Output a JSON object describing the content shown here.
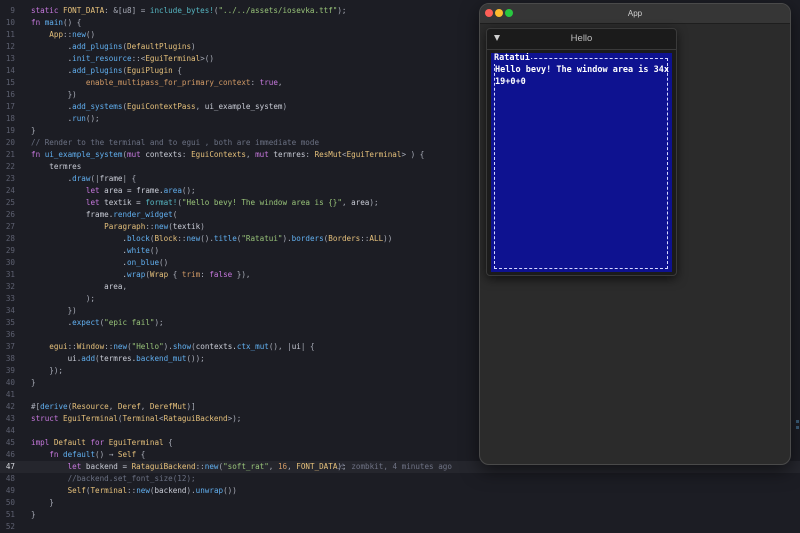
{
  "editor": {
    "lines": [
      {
        "n": "9",
        "parts": [
          [
            "t-kw",
            "static "
          ],
          [
            "t-ty",
            "FONT_DATA"
          ],
          [
            "t-punc",
            ": &[u8] = "
          ],
          [
            "t-mac",
            "include_bytes!"
          ],
          [
            "t-punc",
            "("
          ],
          [
            "t-str",
            "\"../../assets/iosevka.ttf\""
          ],
          [
            "t-punc",
            ");"
          ]
        ]
      },
      {
        "n": "10",
        "parts": [
          [
            "t-kw",
            "fn "
          ],
          [
            "t-fn",
            "main"
          ],
          [
            "t-punc",
            "() {"
          ]
        ]
      },
      {
        "n": "11",
        "parts": [
          [
            "t-plain",
            "    "
          ],
          [
            "t-ty",
            "App"
          ],
          [
            "t-punc",
            "::"
          ],
          [
            "t-fn",
            "new"
          ],
          [
            "t-punc",
            "()"
          ]
        ]
      },
      {
        "n": "12",
        "parts": [
          [
            "t-plain",
            "        ."
          ],
          [
            "t-fn",
            "add_plugins"
          ],
          [
            "t-punc",
            "("
          ],
          [
            "t-ty",
            "DefaultPlugins"
          ],
          [
            "t-punc",
            ")"
          ]
        ]
      },
      {
        "n": "13",
        "parts": [
          [
            "t-plain",
            "        ."
          ],
          [
            "t-fn",
            "init_resource"
          ],
          [
            "t-punc",
            "::<"
          ],
          [
            "t-ty",
            "EguiTerminal"
          ],
          [
            "t-punc",
            ">()"
          ]
        ]
      },
      {
        "n": "14",
        "parts": [
          [
            "t-plain",
            "        ."
          ],
          [
            "t-fn",
            "add_plugins"
          ],
          [
            "t-punc",
            "("
          ],
          [
            "t-ty",
            "EguiPlugin"
          ],
          [
            "t-punc",
            " {"
          ]
        ]
      },
      {
        "n": "15",
        "parts": [
          [
            "t-plain",
            "            "
          ],
          [
            "t-num",
            "enable_multipass_for_primary_context"
          ],
          [
            "t-punc",
            ": "
          ],
          [
            "t-kw",
            "true"
          ],
          [
            "t-punc",
            ","
          ]
        ]
      },
      {
        "n": "16",
        "parts": [
          [
            "t-punc",
            "        })"
          ]
        ]
      },
      {
        "n": "17",
        "parts": [
          [
            "t-plain",
            "        ."
          ],
          [
            "t-fn",
            "add_systems"
          ],
          [
            "t-punc",
            "("
          ],
          [
            "t-ty",
            "EguiContextPass"
          ],
          [
            "t-punc",
            ", "
          ],
          [
            "t-plain",
            "ui_example_system"
          ],
          [
            "t-punc",
            ")"
          ]
        ]
      },
      {
        "n": "18",
        "parts": [
          [
            "t-plain",
            "        ."
          ],
          [
            "t-fn",
            "run"
          ],
          [
            "t-punc",
            "();"
          ]
        ]
      },
      {
        "n": "19",
        "parts": [
          [
            "t-punc",
            "}"
          ]
        ]
      },
      {
        "n": "20",
        "parts": [
          [
            "t-com",
            "// Render to the terminal and to egui , both are immediate mode"
          ]
        ]
      },
      {
        "n": "21",
        "parts": [
          [
            "t-kw",
            "fn "
          ],
          [
            "t-fn",
            "ui_example_system"
          ],
          [
            "t-punc",
            "("
          ],
          [
            "t-kw",
            "mut "
          ],
          [
            "t-plain",
            "contexts"
          ],
          [
            "t-punc",
            ": "
          ],
          [
            "t-ty",
            "EguiContexts"
          ],
          [
            "t-punc",
            ", "
          ],
          [
            "t-kw",
            "mut "
          ],
          [
            "t-plain",
            "termres"
          ],
          [
            "t-punc",
            ": "
          ],
          [
            "t-ty",
            "ResMut"
          ],
          [
            "t-punc",
            "<"
          ],
          [
            "t-ty",
            "EguiTerminal"
          ],
          [
            "t-punc",
            "> ) {"
          ]
        ]
      },
      {
        "n": "22",
        "parts": [
          [
            "t-plain",
            "    termres"
          ]
        ]
      },
      {
        "n": "23",
        "parts": [
          [
            "t-plain",
            "        ."
          ],
          [
            "t-fn",
            "draw"
          ],
          [
            "t-punc",
            "(|"
          ],
          [
            "t-plain",
            "frame"
          ],
          [
            "t-punc",
            "| {"
          ]
        ]
      },
      {
        "n": "24",
        "parts": [
          [
            "t-plain",
            "            "
          ],
          [
            "t-kw",
            "let "
          ],
          [
            "t-plain",
            "area = frame."
          ],
          [
            "t-fn",
            "area"
          ],
          [
            "t-punc",
            "();"
          ]
        ]
      },
      {
        "n": "25",
        "parts": [
          [
            "t-plain",
            "            "
          ],
          [
            "t-kw",
            "let "
          ],
          [
            "t-plain",
            "textik = "
          ],
          [
            "t-mac",
            "format!"
          ],
          [
            "t-punc",
            "("
          ],
          [
            "t-str",
            "\"Hello bevy! The window area is {}\""
          ],
          [
            "t-punc",
            ", "
          ],
          [
            "t-plain",
            "area"
          ],
          [
            "t-punc",
            ");"
          ]
        ]
      },
      {
        "n": "26",
        "parts": [
          [
            "t-plain",
            "            frame."
          ],
          [
            "t-fn",
            "render_widget"
          ],
          [
            "t-punc",
            "("
          ]
        ]
      },
      {
        "n": "27",
        "parts": [
          [
            "t-plain",
            "                "
          ],
          [
            "t-ty",
            "Paragraph"
          ],
          [
            "t-punc",
            "::"
          ],
          [
            "t-fn",
            "new"
          ],
          [
            "t-punc",
            "("
          ],
          [
            "t-plain",
            "textik"
          ],
          [
            "t-punc",
            ")"
          ]
        ]
      },
      {
        "n": "28",
        "parts": [
          [
            "t-plain",
            "                    ."
          ],
          [
            "t-fn",
            "block"
          ],
          [
            "t-punc",
            "("
          ],
          [
            "t-ty",
            "Block"
          ],
          [
            "t-punc",
            "::"
          ],
          [
            "t-fn",
            "new"
          ],
          [
            "t-punc",
            "()."
          ],
          [
            "t-fn",
            "title"
          ],
          [
            "t-punc",
            "("
          ],
          [
            "t-str",
            "\"Ratatui\""
          ],
          [
            "t-punc",
            ")."
          ],
          [
            "t-fn",
            "borders"
          ],
          [
            "t-punc",
            "("
          ],
          [
            "t-ty",
            "Borders"
          ],
          [
            "t-punc",
            "::"
          ],
          [
            "t-ty",
            "ALL"
          ],
          [
            "t-punc",
            "))"
          ]
        ]
      },
      {
        "n": "29",
        "parts": [
          [
            "t-plain",
            "                    ."
          ],
          [
            "t-fn",
            "white"
          ],
          [
            "t-punc",
            "()"
          ]
        ]
      },
      {
        "n": "30",
        "parts": [
          [
            "t-plain",
            "                    ."
          ],
          [
            "t-fn",
            "on_blue"
          ],
          [
            "t-punc",
            "()"
          ]
        ]
      },
      {
        "n": "31",
        "parts": [
          [
            "t-plain",
            "                    ."
          ],
          [
            "t-fn",
            "wrap"
          ],
          [
            "t-punc",
            "("
          ],
          [
            "t-ty",
            "Wrap"
          ],
          [
            "t-punc",
            " { "
          ],
          [
            "t-num",
            "trim"
          ],
          [
            "t-punc",
            ": "
          ],
          [
            "t-kw",
            "false"
          ],
          [
            "t-punc",
            " }),"
          ]
        ]
      },
      {
        "n": "32",
        "parts": [
          [
            "t-plain",
            "                area"
          ],
          [
            "t-punc",
            ","
          ]
        ]
      },
      {
        "n": "33",
        "parts": [
          [
            "t-punc",
            "            );"
          ]
        ]
      },
      {
        "n": "34",
        "parts": [
          [
            "t-punc",
            "        })"
          ]
        ]
      },
      {
        "n": "35",
        "parts": [
          [
            "t-plain",
            "        ."
          ],
          [
            "t-fn",
            "expect"
          ],
          [
            "t-punc",
            "("
          ],
          [
            "t-str",
            "\"epic fail\""
          ],
          [
            "t-punc",
            ");"
          ]
        ]
      },
      {
        "n": "36",
        "parts": []
      },
      {
        "n": "37",
        "parts": [
          [
            "t-plain",
            "    "
          ],
          [
            "t-ty",
            "egui"
          ],
          [
            "t-punc",
            "::"
          ],
          [
            "t-ty",
            "Window"
          ],
          [
            "t-punc",
            "::"
          ],
          [
            "t-fn",
            "new"
          ],
          [
            "t-punc",
            "("
          ],
          [
            "t-str",
            "\"Hello\""
          ],
          [
            "t-punc",
            ")."
          ],
          [
            "t-fn",
            "show"
          ],
          [
            "t-punc",
            "("
          ],
          [
            "t-plain",
            "contexts."
          ],
          [
            "t-fn",
            "ctx_mut"
          ],
          [
            "t-punc",
            "(), |"
          ],
          [
            "t-plain",
            "ui"
          ],
          [
            "t-punc",
            "| {"
          ]
        ]
      },
      {
        "n": "38",
        "parts": [
          [
            "t-plain",
            "        ui."
          ],
          [
            "t-fn",
            "add"
          ],
          [
            "t-punc",
            "("
          ],
          [
            "t-plain",
            "termres."
          ],
          [
            "t-fn",
            "backend_mut"
          ],
          [
            "t-punc",
            "());"
          ]
        ]
      },
      {
        "n": "39",
        "parts": [
          [
            "t-punc",
            "    });"
          ]
        ]
      },
      {
        "n": "40",
        "parts": [
          [
            "t-punc",
            "}"
          ]
        ]
      },
      {
        "n": "41",
        "parts": []
      },
      {
        "n": "42",
        "parts": [
          [
            "t-punc",
            "#["
          ],
          [
            "t-fn",
            "derive"
          ],
          [
            "t-punc",
            "("
          ],
          [
            "t-ty",
            "Resource"
          ],
          [
            "t-punc",
            ", "
          ],
          [
            "t-ty",
            "Deref"
          ],
          [
            "t-punc",
            ", "
          ],
          [
            "t-ty",
            "DerefMut"
          ],
          [
            "t-punc",
            ")]"
          ]
        ]
      },
      {
        "n": "43",
        "parts": [
          [
            "t-kw",
            "struct "
          ],
          [
            "t-ty",
            "EguiTerminal"
          ],
          [
            "t-punc",
            "("
          ],
          [
            "t-ty",
            "Terminal"
          ],
          [
            "t-punc",
            "<"
          ],
          [
            "t-ty",
            "RataguiBackend"
          ],
          [
            "t-punc",
            ">);"
          ]
        ]
      },
      {
        "n": "44",
        "parts": []
      },
      {
        "n": "45",
        "parts": [
          [
            "t-kw",
            "impl "
          ],
          [
            "t-ty",
            "Default "
          ],
          [
            "t-kw",
            "for "
          ],
          [
            "t-ty",
            "EguiTerminal"
          ],
          [
            "t-punc",
            " {"
          ]
        ]
      },
      {
        "n": "46",
        "parts": [
          [
            "t-plain",
            "    "
          ],
          [
            "t-kw",
            "fn "
          ],
          [
            "t-fn",
            "default"
          ],
          [
            "t-punc",
            "() → "
          ],
          [
            "t-ty",
            "Self"
          ],
          [
            "t-punc",
            " {"
          ]
        ]
      },
      {
        "n": "47",
        "current": true,
        "parts": [
          [
            "t-plain",
            "        "
          ],
          [
            "t-kw",
            "let "
          ],
          [
            "t-plain",
            "backend = "
          ],
          [
            "t-ty",
            "RataguiBackend"
          ],
          [
            "t-punc",
            "::"
          ],
          [
            "t-fn",
            "new"
          ],
          [
            "t-punc",
            "("
          ],
          [
            "t-str",
            "\"soft_rat\""
          ],
          [
            "t-punc",
            ", "
          ],
          [
            "t-num",
            "16"
          ],
          [
            "t-punc",
            ", "
          ],
          [
            "t-ty",
            "FONT_DATA"
          ],
          [
            "t-punc",
            ");"
          ]
        ]
      },
      {
        "n": "48",
        "parts": [
          [
            "t-com",
            "        //backend.set_font_size(12);"
          ]
        ]
      },
      {
        "n": "49",
        "parts": [
          [
            "t-plain",
            "        "
          ],
          [
            "t-ty",
            "Self"
          ],
          [
            "t-punc",
            "("
          ],
          [
            "t-ty",
            "Terminal"
          ],
          [
            "t-punc",
            "::"
          ],
          [
            "t-fn",
            "new"
          ],
          [
            "t-punc",
            "("
          ],
          [
            "t-plain",
            "backend"
          ],
          [
            "t-punc",
            ")."
          ],
          [
            "t-fn",
            "unwrap"
          ],
          [
            "t-punc",
            "())"
          ]
        ]
      },
      {
        "n": "50",
        "parts": [
          [
            "t-punc",
            "    }"
          ]
        ]
      },
      {
        "n": "51",
        "parts": [
          [
            "t-punc",
            "}"
          ]
        ]
      },
      {
        "n": "52",
        "parts": []
      }
    ],
    "blame": "zombkit, 4 minutes ago"
  },
  "window": {
    "title": "App",
    "egui_title": "Hello",
    "terminal": {
      "block_title": "Ratatui",
      "text": "Hello bevy! The window area is 34x19+0+0"
    }
  },
  "colors": {
    "terminal_bg": "#0e1290",
    "editor_bg": "#1c1d24"
  }
}
